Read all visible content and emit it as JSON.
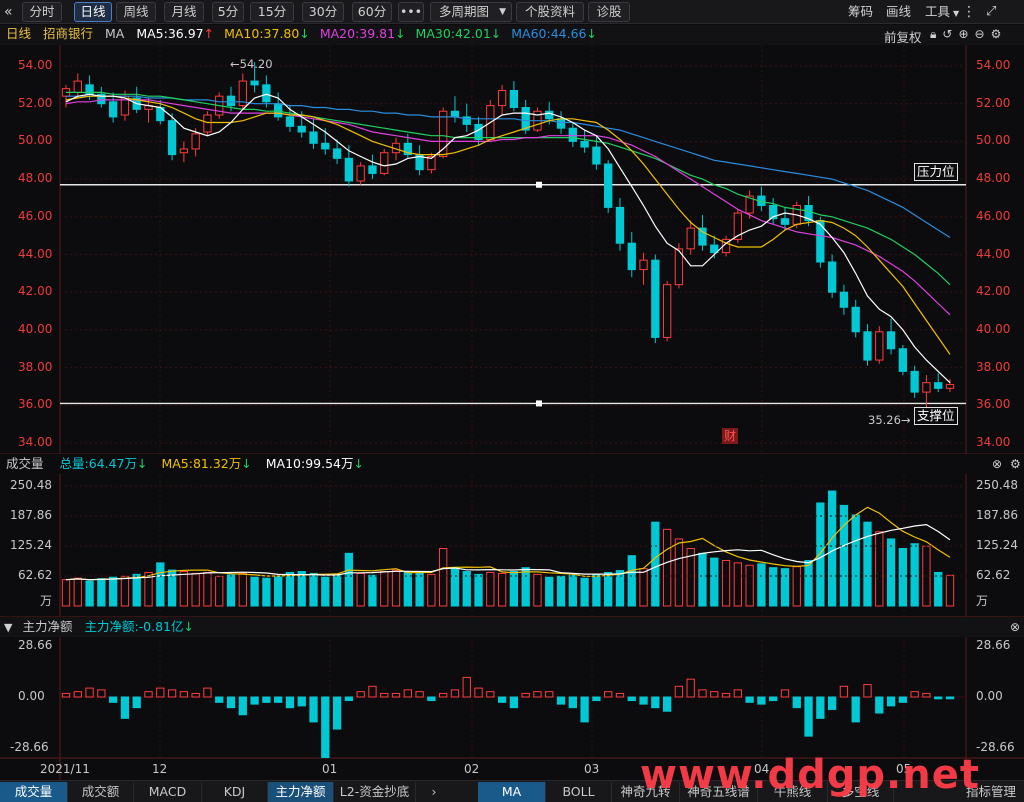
{
  "toolbar": {
    "back_icon": "«",
    "tabs": [
      "分时",
      "日线",
      "周线",
      "月线",
      "5分",
      "15分",
      "30分",
      "60分"
    ],
    "active": "日线",
    "more": "•••",
    "multi_period": "多周期图",
    "stock_info": "个股资料",
    "diagnose": "诊股",
    "chips": "筹码",
    "draw": "画线",
    "tools": "工具",
    "icons": [
      "menu-dots-icon",
      "fullscreen-icon"
    ]
  },
  "main": {
    "period": "日线",
    "stock_name": "招商银行",
    "ma_label": "MA",
    "ma5": "MA5:36.97",
    "ma10": "MA10:37.80",
    "ma20": "MA20:39.81",
    "ma30": "MA30:42.01",
    "ma60": "MA60:44.66",
    "adjust": "前复权",
    "high_label": "54.20",
    "low_label": "35.26",
    "resistance_label": "压力位",
    "support_label": "支撑位",
    "fin_badge": "财"
  },
  "volume": {
    "title": "成交量",
    "total": "总量:64.47万",
    "ma5": "MA5:81.32万",
    "ma10": "MA10:99.54万",
    "unit": "万"
  },
  "flow": {
    "title": "主力净额",
    "value": "主力净额:-0.81亿"
  },
  "axes": {
    "price_ticks": [
      "54.00",
      "52.00",
      "50.00",
      "48.00",
      "46.00",
      "44.00",
      "42.00",
      "40.00",
      "38.00",
      "36.00",
      "34.00"
    ],
    "volume_ticks": [
      "250.48",
      "187.86",
      "125.24",
      "62.62"
    ],
    "flow_ticks": [
      "28.66",
      "0.00",
      "-28.66"
    ],
    "date_ticks": [
      "2021/11",
      "12",
      "01",
      "02",
      "03",
      "04",
      "05"
    ]
  },
  "bottom_tabs_left": [
    "成交量",
    "成交额",
    "MACD",
    "KDJ",
    "主力净额",
    "L2-资金抄底"
  ],
  "bottom_tabs_right": [
    "MA",
    "BOLL",
    "神奇九转",
    "神奇五线谱",
    "牛熊线",
    "多空线"
  ],
  "bottom_right_label": "指标管理",
  "watermark": "www.ddgp.net",
  "colors": {
    "up": "#ff3c3c",
    "down": "#00c8d4",
    "ma5": "#ffffff",
    "ma10": "#f0c000",
    "ma20": "#e040e0",
    "ma30": "#20d060",
    "ma60": "#2a8de0",
    "hline": "#ffffff"
  },
  "chart_data": {
    "type": "candlestick",
    "price_range": [
      34.0,
      55.0
    ],
    "resistance": 47.7,
    "support": 36.1,
    "candles_note": "OHLC values estimated from the image, in chronological order",
    "ohlc": [
      [
        52.4,
        53.0,
        51.8,
        52.8
      ],
      [
        52.6,
        53.6,
        52.3,
        53.2
      ],
      [
        53.0,
        53.5,
        52.2,
        52.5
      ],
      [
        52.5,
        52.9,
        51.8,
        52.0
      ],
      [
        52.1,
        52.6,
        51.0,
        51.3
      ],
      [
        51.4,
        52.7,
        51.1,
        52.4
      ],
      [
        52.3,
        52.9,
        51.5,
        51.7
      ],
      [
        51.7,
        52.3,
        51.0,
        51.9
      ],
      [
        51.8,
        52.2,
        50.9,
        51.1
      ],
      [
        51.1,
        51.5,
        49.0,
        49.3
      ],
      [
        49.4,
        50.0,
        48.9,
        49.6
      ],
      [
        49.6,
        50.7,
        49.2,
        50.4
      ],
      [
        50.5,
        51.6,
        50.3,
        51.4
      ],
      [
        51.4,
        52.6,
        51.2,
        52.4
      ],
      [
        52.4,
        52.9,
        51.6,
        51.9
      ],
      [
        51.9,
        53.6,
        51.7,
        53.2
      ],
      [
        53.2,
        54.2,
        52.6,
        53.0
      ],
      [
        53.0,
        53.5,
        51.8,
        52.1
      ],
      [
        52.0,
        52.6,
        51.1,
        51.3
      ],
      [
        51.3,
        51.9,
        50.5,
        50.8
      ],
      [
        50.8,
        51.6,
        50.2,
        50.5
      ],
      [
        50.5,
        51.2,
        49.6,
        49.9
      ],
      [
        49.9,
        50.7,
        49.3,
        49.6
      ],
      [
        49.6,
        50.1,
        48.8,
        49.1
      ],
      [
        49.1,
        49.8,
        47.6,
        47.9
      ],
      [
        47.9,
        48.9,
        47.7,
        48.7
      ],
      [
        48.7,
        49.3,
        48.0,
        48.3
      ],
      [
        48.3,
        49.6,
        48.2,
        49.4
      ],
      [
        49.4,
        50.2,
        49.0,
        49.9
      ],
      [
        49.9,
        50.4,
        49.1,
        49.3
      ],
      [
        49.3,
        49.8,
        48.2,
        48.5
      ],
      [
        48.5,
        49.4,
        48.3,
        49.2
      ],
      [
        49.2,
        51.8,
        49.1,
        51.6
      ],
      [
        51.6,
        52.4,
        51.0,
        51.3
      ],
      [
        51.3,
        52.0,
        50.5,
        50.9
      ],
      [
        50.9,
        51.3,
        49.8,
        50.1
      ],
      [
        50.1,
        52.2,
        50.0,
        51.9
      ],
      [
        51.9,
        53.0,
        51.4,
        52.7
      ],
      [
        52.7,
        53.2,
        51.6,
        51.8
      ],
      [
        51.8,
        52.2,
        50.4,
        50.6
      ],
      [
        50.6,
        51.8,
        50.5,
        51.6
      ],
      [
        51.6,
        52.1,
        50.9,
        51.2
      ],
      [
        51.2,
        51.6,
        50.4,
        50.7
      ],
      [
        50.7,
        51.0,
        49.7,
        50.0
      ],
      [
        50.0,
        50.6,
        49.4,
        49.7
      ],
      [
        49.7,
        50.3,
        48.5,
        48.8
      ],
      [
        48.8,
        49.0,
        46.2,
        46.5
      ],
      [
        46.5,
        47.0,
        44.2,
        44.6
      ],
      [
        44.6,
        45.2,
        42.8,
        43.2
      ],
      [
        43.2,
        44.1,
        42.4,
        43.7
      ],
      [
        43.7,
        44.0,
        39.3,
        39.6
      ],
      [
        39.6,
        42.6,
        39.4,
        42.4
      ],
      [
        42.4,
        44.6,
        42.2,
        44.3
      ],
      [
        44.3,
        45.8,
        44.0,
        45.4
      ],
      [
        45.4,
        46.1,
        44.2,
        44.5
      ],
      [
        44.5,
        45.0,
        43.8,
        44.1
      ],
      [
        44.1,
        45.0,
        43.9,
        44.8
      ],
      [
        44.8,
        46.4,
        44.6,
        46.2
      ],
      [
        46.2,
        47.4,
        45.9,
        47.1
      ],
      [
        47.1,
        47.6,
        46.3,
        46.6
      ],
      [
        46.6,
        47.0,
        45.6,
        45.9
      ],
      [
        45.9,
        46.5,
        45.3,
        45.6
      ],
      [
        45.6,
        46.8,
        45.4,
        46.6
      ],
      [
        46.6,
        47.1,
        45.5,
        45.8
      ],
      [
        45.8,
        46.0,
        43.3,
        43.6
      ],
      [
        43.6,
        44.0,
        41.7,
        42.0
      ],
      [
        42.0,
        42.4,
        40.8,
        41.2
      ],
      [
        41.2,
        41.6,
        39.6,
        39.9
      ],
      [
        39.9,
        40.3,
        38.1,
        38.4
      ],
      [
        38.4,
        40.2,
        38.2,
        39.9
      ],
      [
        39.9,
        40.6,
        38.7,
        39.0
      ],
      [
        39.0,
        39.2,
        37.6,
        37.8
      ],
      [
        37.8,
        38.1,
        36.4,
        36.7
      ],
      [
        36.7,
        37.6,
        35.3,
        37.2
      ],
      [
        37.2,
        37.7,
        36.7,
        36.9
      ],
      [
        36.9,
        37.4,
        36.7,
        37.1
      ]
    ],
    "volume_values": [
      55,
      58,
      52,
      57,
      60,
      62,
      66,
      70,
      90,
      75,
      72,
      68,
      70,
      62,
      65,
      68,
      60,
      58,
      62,
      70,
      72,
      68,
      60,
      65,
      110,
      68,
      64,
      72,
      75,
      70,
      68,
      66,
      120,
      80,
      72,
      66,
      70,
      68,
      72,
      80,
      66,
      60,
      62,
      64,
      58,
      66,
      70,
      74,
      105,
      78,
      175,
      160,
      140,
      120,
      110,
      100,
      95,
      90,
      85,
      88,
      80,
      78,
      82,
      95,
      215,
      240,
      210,
      190,
      175,
      155,
      140,
      120,
      130,
      125,
      70,
      64
    ],
    "flow_values": [
      2,
      3,
      5,
      4,
      -3,
      -12,
      -6,
      3,
      5,
      4,
      3,
      2,
      5,
      -3,
      -6,
      -10,
      -4,
      -3,
      -3,
      -6,
      -5,
      -14,
      -34,
      -18,
      -2,
      3,
      6,
      2,
      2,
      4,
      3,
      -2,
      2,
      4,
      11,
      5,
      3,
      -3,
      -6,
      2,
      3,
      3,
      -4,
      -6,
      -14,
      -2,
      3,
      2,
      -2,
      -4,
      -6,
      -8,
      6,
      10,
      4,
      3,
      2,
      4,
      -3,
      -4,
      -2,
      4,
      -6,
      -22,
      -12,
      -7,
      6,
      -14,
      7,
      -9,
      -5,
      -3,
      3,
      2,
      -1,
      -1
    ],
    "ma5": [
      52.1,
      52.4,
      52.5,
      52.4,
      52.4,
      52.3,
      52.0,
      51.9,
      51.8,
      51.3,
      50.7,
      50.5,
      50.3,
      50.5,
      51.0,
      51.7,
      52.3,
      52.5,
      52.3,
      51.7,
      51.3,
      50.9,
      50.5,
      50.0,
      49.5,
      49.2,
      48.9,
      48.7,
      48.8,
      49.1,
      49.2,
      49.1,
      49.6,
      50.2,
      50.3,
      50.6,
      51.0,
      51.4,
      51.5,
      51.5,
      51.4,
      51.5,
      51.3,
      51.0,
      50.6,
      50.3,
      49.6,
      48.6,
      47.6,
      46.6,
      45.5,
      44.6,
      44.2,
      43.4,
      43.4,
      44.0,
      44.6,
      45.0,
      45.3,
      45.5,
      46.0,
      46.2,
      46.1,
      45.9,
      45.6,
      44.9,
      44.1,
      43.0,
      41.8,
      41.1,
      40.7,
      40.0,
      39.1,
      38.4,
      37.8,
      37.2
    ],
    "ma10": [
      52.2,
      52.3,
      52.4,
      52.4,
      52.4,
      52.3,
      52.2,
      52.1,
      52.0,
      51.8,
      51.5,
      51.2,
      51.0,
      51.0,
      51.0,
      51.1,
      51.3,
      51.5,
      51.5,
      51.4,
      51.4,
      51.3,
      51.1,
      50.9,
      50.6,
      50.3,
      50.0,
      49.8,
      49.6,
      49.4,
      49.3,
      49.3,
      49.3,
      49.4,
      49.6,
      49.8,
      50.1,
      50.3,
      50.5,
      50.7,
      50.9,
      51.1,
      51.2,
      51.2,
      51.1,
      51.0,
      50.6,
      50.1,
      49.5,
      48.8,
      48.0,
      47.2,
      46.4,
      45.7,
      45.2,
      44.9,
      44.6,
      44.4,
      44.4,
      44.4,
      44.8,
      45.3,
      45.6,
      45.7,
      45.8,
      45.7,
      45.4,
      45.0,
      44.4,
      43.7,
      43.0,
      42.3,
      41.4,
      40.5,
      39.6,
      38.7
    ],
    "ma20": [
      52.0,
      52.1,
      52.1,
      52.2,
      52.2,
      52.2,
      52.2,
      52.2,
      52.1,
      52.0,
      51.9,
      51.8,
      51.7,
      51.6,
      51.5,
      51.5,
      51.5,
      51.5,
      51.5,
      51.4,
      51.3,
      51.2,
      51.1,
      51.0,
      50.9,
      50.7,
      50.5,
      50.4,
      50.3,
      50.2,
      50.1,
      50.0,
      50.0,
      50.0,
      50.0,
      50.0,
      50.0,
      50.1,
      50.1,
      50.2,
      50.2,
      50.3,
      50.3,
      50.3,
      50.3,
      50.3,
      50.2,
      50.0,
      49.8,
      49.5,
      49.2,
      48.8,
      48.4,
      48.0,
      47.6,
      47.2,
      46.8,
      46.4,
      46.1,
      45.8,
      45.6,
      45.4,
      45.2,
      45.1,
      45.0,
      44.9,
      44.7,
      44.5,
      44.2,
      43.9,
      43.5,
      43.1,
      42.6,
      42.0,
      41.4,
      40.8
    ],
    "ma30": [
      52.6,
      52.6,
      52.6,
      52.6,
      52.5,
      52.5,
      52.5,
      52.4,
      52.4,
      52.3,
      52.2,
      52.1,
      52.0,
      51.9,
      51.8,
      51.7,
      51.7,
      51.6,
      51.6,
      51.5,
      51.4,
      51.3,
      51.2,
      51.1,
      51.0,
      50.9,
      50.8,
      50.7,
      50.6,
      50.5,
      50.4,
      50.3,
      50.3,
      50.2,
      50.2,
      50.2,
      50.2,
      50.2,
      50.2,
      50.2,
      50.2,
      50.2,
      50.2,
      50.2,
      50.1,
      50.0,
      49.9,
      49.7,
      49.5,
      49.3,
      49.1,
      48.8,
      48.5,
      48.2,
      48.0,
      47.7,
      47.5,
      47.2,
      47.0,
      46.8,
      46.7,
      46.5,
      46.4,
      46.3,
      46.1,
      46.0,
      45.8,
      45.6,
      45.4,
      45.1,
      44.8,
      44.4,
      44.0,
      43.5,
      43.0,
      42.4
    ],
    "ma60": [
      52.4,
      52.4,
      52.4,
      52.4,
      52.4,
      52.4,
      52.4,
      52.3,
      52.3,
      52.3,
      52.2,
      52.2,
      52.2,
      52.1,
      52.1,
      52.1,
      52.0,
      52.0,
      52.0,
      51.9,
      51.9,
      51.8,
      51.8,
      51.7,
      51.7,
      51.6,
      51.6,
      51.5,
      51.5,
      51.4,
      51.4,
      51.3,
      51.3,
      51.3,
      51.2,
      51.2,
      51.2,
      51.2,
      51.2,
      51.1,
      51.1,
      51.1,
      51.0,
      51.0,
      50.9,
      50.8,
      50.7,
      50.6,
      50.4,
      50.2,
      50.0,
      49.8,
      49.6,
      49.4,
      49.2,
      49.0,
      48.9,
      48.8,
      48.7,
      48.6,
      48.5,
      48.4,
      48.3,
      48.2,
      48.1,
      48.0,
      47.8,
      47.6,
      47.4,
      47.1,
      46.8,
      46.5,
      46.1,
      45.7,
      45.3,
      44.9
    ]
  }
}
